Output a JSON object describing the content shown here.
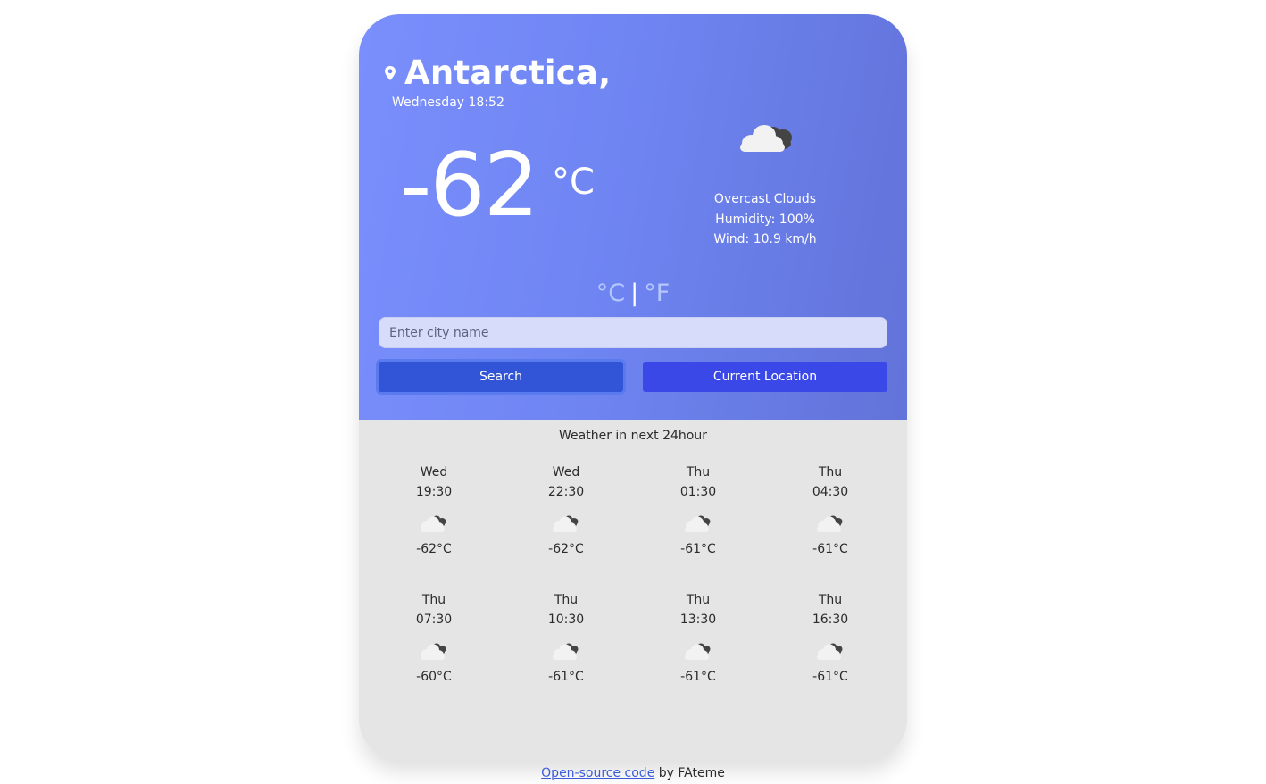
{
  "location": {
    "city": "Antarctica,",
    "datetime": "Wednesday 18:52"
  },
  "current": {
    "temperature": "-62",
    "unit": "°C",
    "condition": "Overcast Clouds",
    "humidity": "Humidity: 100%",
    "wind": "Wind: 10.9 km/h",
    "icon": "overcast-clouds-icon"
  },
  "unit_toggle": {
    "celsius": "°C",
    "separator": "|",
    "fahrenheit": "°F"
  },
  "search": {
    "placeholder": "Enter city name",
    "value": ""
  },
  "buttons": {
    "search": "Search",
    "current_location": "Current Location"
  },
  "forecast": {
    "title": "Weather in next 24hour",
    "items": [
      {
        "day": "Wed",
        "time": "19:30",
        "temp": "-62°C",
        "icon": "overcast-clouds-icon"
      },
      {
        "day": "Wed",
        "time": "22:30",
        "temp": "-62°C",
        "icon": "overcast-clouds-icon"
      },
      {
        "day": "Thu",
        "time": "01:30",
        "temp": "-61°C",
        "icon": "overcast-clouds-icon"
      },
      {
        "day": "Thu",
        "time": "04:30",
        "temp": "-61°C",
        "icon": "overcast-clouds-icon"
      },
      {
        "day": "Thu",
        "time": "07:30",
        "temp": "-60°C",
        "icon": "overcast-clouds-icon"
      },
      {
        "day": "Thu",
        "time": "10:30",
        "temp": "-61°C",
        "icon": "overcast-clouds-icon"
      },
      {
        "day": "Thu",
        "time": "13:30",
        "temp": "-61°C",
        "icon": "overcast-clouds-icon"
      },
      {
        "day": "Thu",
        "time": "16:30",
        "temp": "-61°C",
        "icon": "overcast-clouds-icon"
      }
    ]
  },
  "footer": {
    "link_text": "Open-source code",
    "suffix": " by FAteme"
  },
  "colors": {
    "header_gradient_start": "#7a8ffc",
    "header_gradient_end": "#6273d9",
    "search_button": "#3254d6",
    "location_button": "#3b48e8",
    "card_background": "#e5e5e5"
  }
}
